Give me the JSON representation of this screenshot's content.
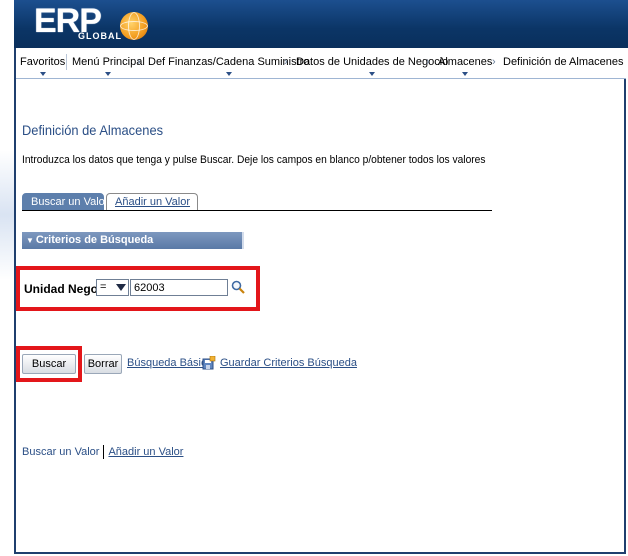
{
  "brand": {
    "logo_text": "ERP",
    "logo_sub": "GLOBAL",
    "colors": {
      "header_blue": "#0b3566",
      "link_blue": "#2b4f86",
      "highlight_red": "#e3161a",
      "tab_blue": "#5d7fac"
    }
  },
  "nav": {
    "items": [
      "Favoritos",
      "Menú Principal",
      "Def Finanzas/Cadena Suministro",
      "Datos de Unidades de Negocio",
      "Almacenes",
      "Definición de Almacenes"
    ],
    "separator": "›"
  },
  "page": {
    "title": "Definición de Almacenes",
    "instructions": "Introduzca los datos que tenga y pulse Buscar. Deje los campos en blanco p/obtener todos los valores"
  },
  "tabs": [
    {
      "label": "Buscar un Valor",
      "active": true
    },
    {
      "label": "Añadir un Valor",
      "active": false
    }
  ],
  "search": {
    "section_title": "Criterios de Búsqueda",
    "field_label": "Unidad Negocio:",
    "operator": "=",
    "value": "62003",
    "lookup_icon": "magnifier-icon"
  },
  "actions": {
    "buscar": "Buscar",
    "borrar": "Borrar",
    "busqueda_basica": "Búsqueda Básica",
    "guardar": "Guardar Criterios Búsqueda",
    "guardar_icon": "save-criteria-icon"
  },
  "footer_links": {
    "buscar": "Buscar un Valor",
    "anadir": "Añadir un Valor"
  }
}
